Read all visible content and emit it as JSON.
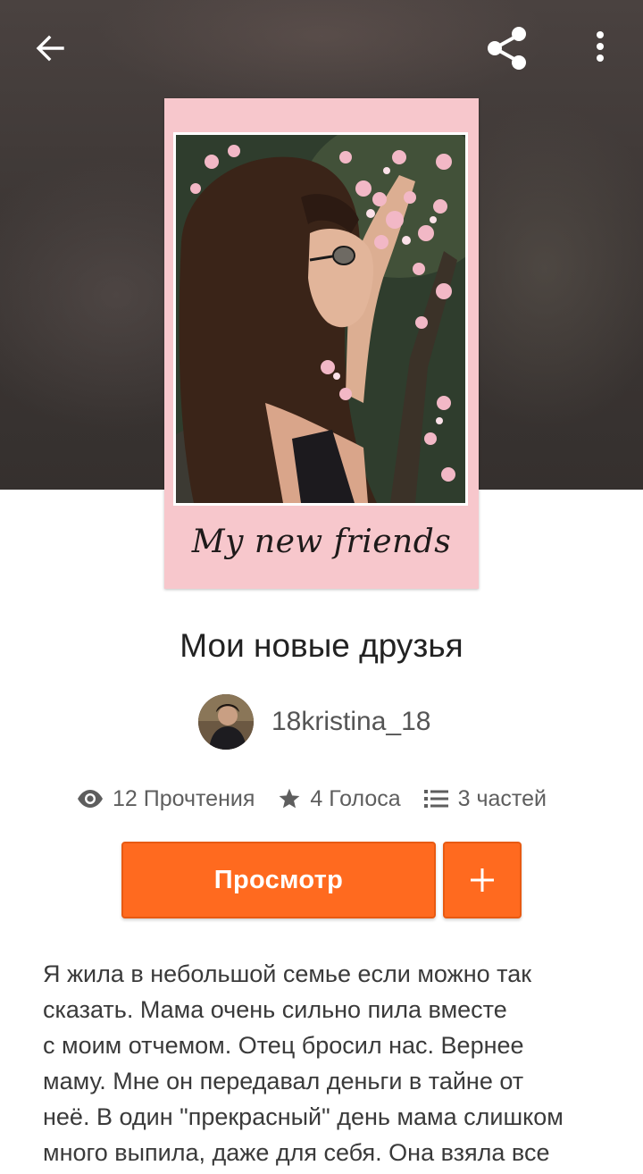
{
  "header": {
    "back_icon": "arrow-left-icon",
    "share_icon": "share-icon",
    "more_icon": "more-vertical-icon"
  },
  "cover": {
    "title_text": "My new friends",
    "background_color": "#f7c7cc"
  },
  "story": {
    "title": "Мои новые друзья",
    "author": "18kristina_18"
  },
  "stats": {
    "reads": "12 Прочтения",
    "votes": "4 Голоса",
    "parts": "3 частей"
  },
  "actions": {
    "read_label": "Просмотр",
    "add_label": "+",
    "accent_color": "#ff6a1f"
  },
  "description": "Я жила в небольшой семье если можно так\nсказать. Мама очень сильно пила вместе\nс моим отчемом. Отец бросил нас. Вернее\nмаму. Мне он передавал деньги в тайне от\nнеё. В один \"прекрасный\" день мама слишком\nмного выпила, даже для себя. Она взяла все"
}
